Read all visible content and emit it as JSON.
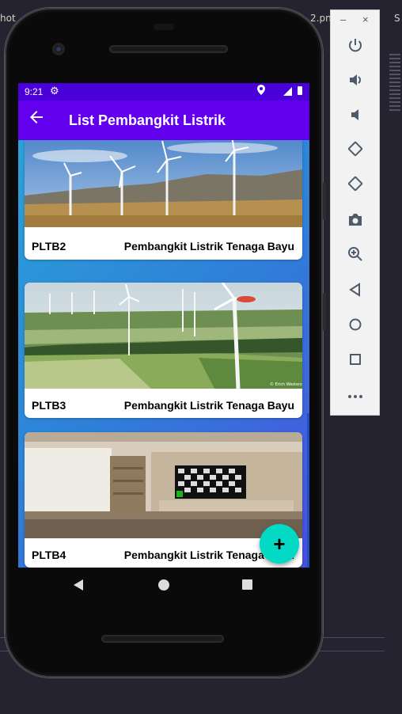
{
  "background": {
    "tab_text_left": "hot",
    "tab_text_right": "2.pn",
    "tab_text_far": "S"
  },
  "status_bar": {
    "time": "9:21"
  },
  "app_bar": {
    "title": "List Pembangkit Listrik"
  },
  "cards": [
    {
      "code": "PLTB2",
      "description": "Pembangkit Listrik Tenaga Bayu"
    },
    {
      "code": "PLTB3",
      "description": "Pembangkit Listrik Tenaga Bayu"
    },
    {
      "code": "PLTB4",
      "description": "Pembangkit Listrik Tenaga Bayu"
    }
  ],
  "fab": {
    "label": "+"
  },
  "emulator_toolbar": {
    "minimize": "–",
    "close": "×",
    "tools": [
      "power-icon",
      "volume-up-icon",
      "volume-down-icon",
      "rotate-left-icon",
      "rotate-right-icon",
      "camera-icon",
      "zoom-icon",
      "back-icon",
      "home-icon",
      "overview-icon",
      "more-icon"
    ]
  },
  "colors": {
    "status_bar": "#4a00d8",
    "app_bar": "#6200ee",
    "fab": "#03dac5"
  }
}
